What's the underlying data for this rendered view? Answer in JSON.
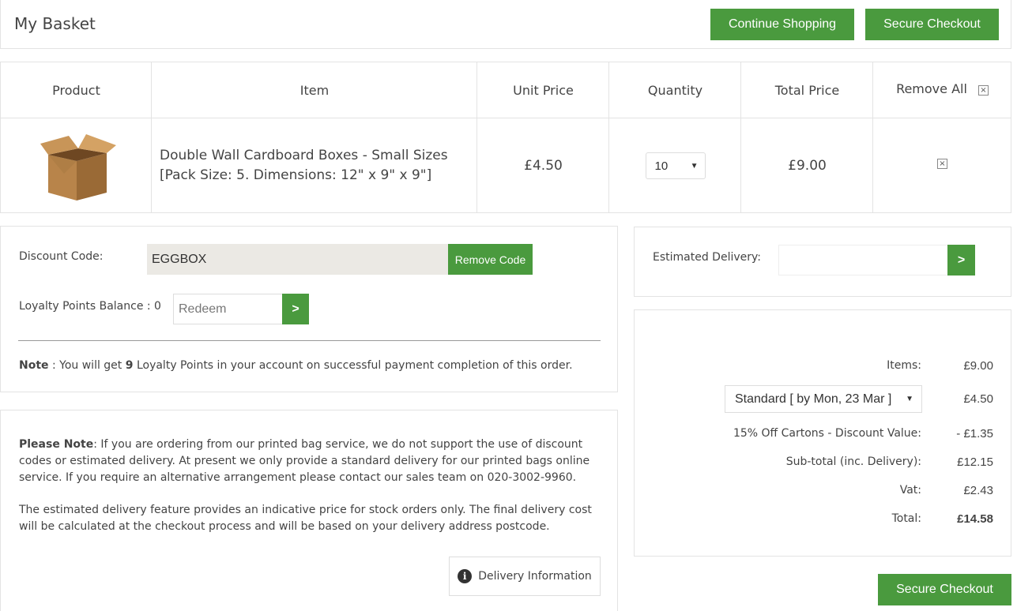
{
  "header": {
    "title": "My Basket",
    "continue_label": "Continue Shopping",
    "checkout_label": "Secure Checkout"
  },
  "table": {
    "headers": [
      "Product",
      "Item",
      "Unit Price",
      "Quantity",
      "Total Price",
      "Remove All"
    ],
    "remove_all_icon": "close-icon",
    "rows": [
      {
        "image": "cardboard-box",
        "name_line1": "Double Wall Cardboard Boxes - Small Sizes",
        "name_line2": "[Pack Size: 5.  Dimensions: 12\" x 9\" x 9\"]",
        "unit_price": "£4.50",
        "quantity": "10",
        "total": "£9.00"
      }
    ]
  },
  "discount": {
    "code_label": "Discount Code:",
    "code_value": "EGGBOX",
    "remove_label": "Remove Code",
    "loyalty_label": "Loyalty  Points  Balance : 0",
    "redeem_placeholder": "Redeem",
    "go_label": ">",
    "note_prefix": "Note",
    "note_mid": " : You will get ",
    "note_points": "9",
    "note_suffix": "  Loyalty  Points in your account on successful payment completion of this order."
  },
  "info": {
    "para1_bold": "Please  Note",
    "para1_text": ":  If you are ordering from our printed bag service, we do not support the use of discount codes or estimated delivery. At present we only provide a standard delivery for our printed bags online service.  If you require an alternative arrangement please contact our sales team on 020-3002-9960.",
    "para2_text": "The estimated delivery feature provides an indicative price for stock orders only. The final delivery cost will be calculated at the checkout process and will be based on your delivery address postcode.",
    "delivery_info_label": "Delivery Information"
  },
  "estimate": {
    "label": "Estimated Delivery:",
    "postcode_value": "",
    "go_label": ">"
  },
  "totals": {
    "items_label": "Items:",
    "items_value": "£9.00",
    "shipping_option": "Standard [ by Mon, 23 Mar ]",
    "shipping_value": "£4.50",
    "discount_label": "15% Off Cartons -  Discount Value:",
    "discount_value": "- £1.35",
    "subtotal_label": "Sub-total (inc. Delivery):",
    "subtotal_value": "£12.15",
    "vat_label": "Vat:",
    "vat_value": "£2.43",
    "total_label": "Total:",
    "total_value": "£14.58"
  },
  "colors": {
    "accent": "#4a9a3e",
    "border": "#e3e3e3"
  }
}
